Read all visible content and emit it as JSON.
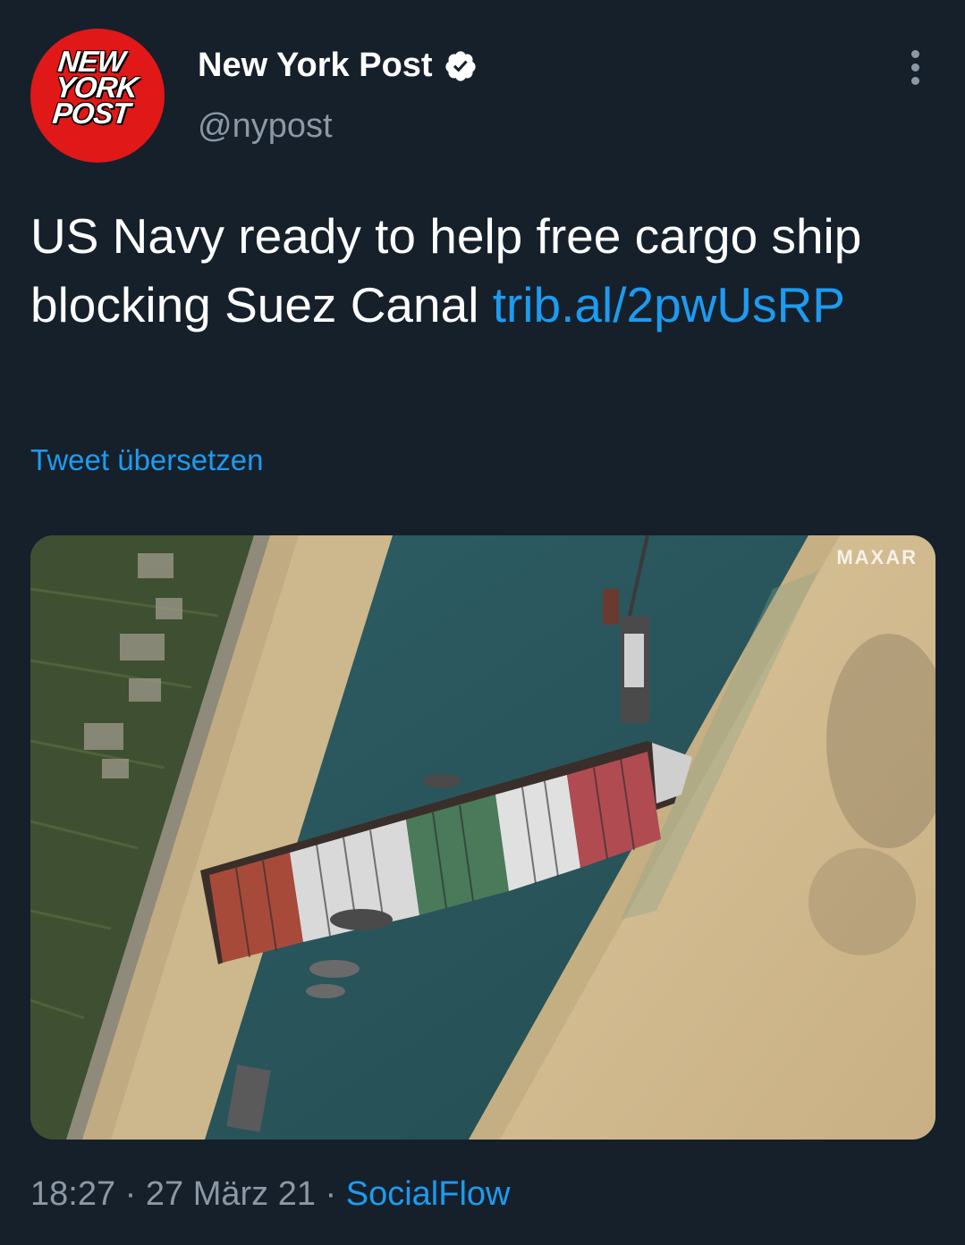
{
  "account": {
    "name": "New York Post",
    "handle": "@nypost",
    "avatar_logo_lines": [
      "NEW",
      "YORK",
      "POST"
    ]
  },
  "tweet": {
    "text": "US Navy ready to help free cargo ship blocking Suez Canal ",
    "link": "trib.al/2pwUsRP",
    "translate_label": "Tweet übersetzen",
    "media_watermark": "MAXAR",
    "time": "18:27",
    "separator": " · ",
    "date": "27 März 21",
    "source": "SocialFlow"
  },
  "icons": {
    "verified": "verified-badge-icon",
    "more": "more-vertical-icon"
  },
  "colors": {
    "background": "#15202b",
    "text": "#ffffff",
    "secondary_text": "#8b98a5",
    "link": "#1d9bf0",
    "avatar_red": "#e01818"
  }
}
